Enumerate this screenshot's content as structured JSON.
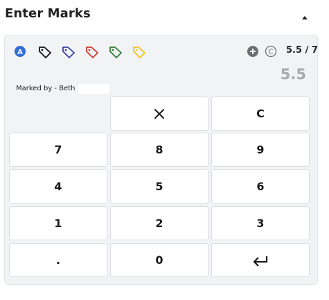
{
  "header": {
    "title": "Enter Marks",
    "collapse_icon": "caret-up-icon"
  },
  "toolbar": {
    "tags": [
      {
        "name": "annotation-a-icon",
        "color": "#2f6fd6",
        "letter": "A"
      },
      {
        "name": "tag-black-icon",
        "color": "#111111"
      },
      {
        "name": "tag-blue-icon",
        "color": "#3a3fa8"
      },
      {
        "name": "tag-red-icon",
        "color": "#d23a2c"
      },
      {
        "name": "tag-green-icon",
        "color": "#2e7d32"
      },
      {
        "name": "tag-yellow-icon",
        "color": "#f2c21a"
      }
    ],
    "add_icon": "plus-circle-icon",
    "copyright_icon": "copyright-icon",
    "copyright_letter": "C",
    "score": "5.5",
    "score_sep": "/",
    "max": "7"
  },
  "current_score": "5.5",
  "marked_by": "Marked by - Beth",
  "keypad": {
    "keys": [
      {
        "label": "",
        "name": "keypad-empty-slot",
        "kind": "empty"
      },
      {
        "label": "",
        "name": "clear-entry-button",
        "kind": "icon",
        "icon": "close-icon"
      },
      {
        "label": "C",
        "name": "clear-button",
        "kind": "text"
      },
      {
        "label": "7",
        "name": "digit-7-button",
        "kind": "text"
      },
      {
        "label": "8",
        "name": "digit-8-button",
        "kind": "text"
      },
      {
        "label": "9",
        "name": "digit-9-button",
        "kind": "text"
      },
      {
        "label": "4",
        "name": "digit-4-button",
        "kind": "text"
      },
      {
        "label": "5",
        "name": "digit-5-button",
        "kind": "text"
      },
      {
        "label": "6",
        "name": "digit-6-button",
        "kind": "text"
      },
      {
        "label": "1",
        "name": "digit-1-button",
        "kind": "text"
      },
      {
        "label": "2",
        "name": "digit-2-button",
        "kind": "text"
      },
      {
        "label": "3",
        "name": "digit-3-button",
        "kind": "text"
      },
      {
        "label": ".",
        "name": "decimal-button",
        "kind": "text"
      },
      {
        "label": "0",
        "name": "digit-0-button",
        "kind": "text"
      },
      {
        "label": "",
        "name": "enter-button",
        "kind": "icon",
        "icon": "enter-icon"
      }
    ]
  }
}
